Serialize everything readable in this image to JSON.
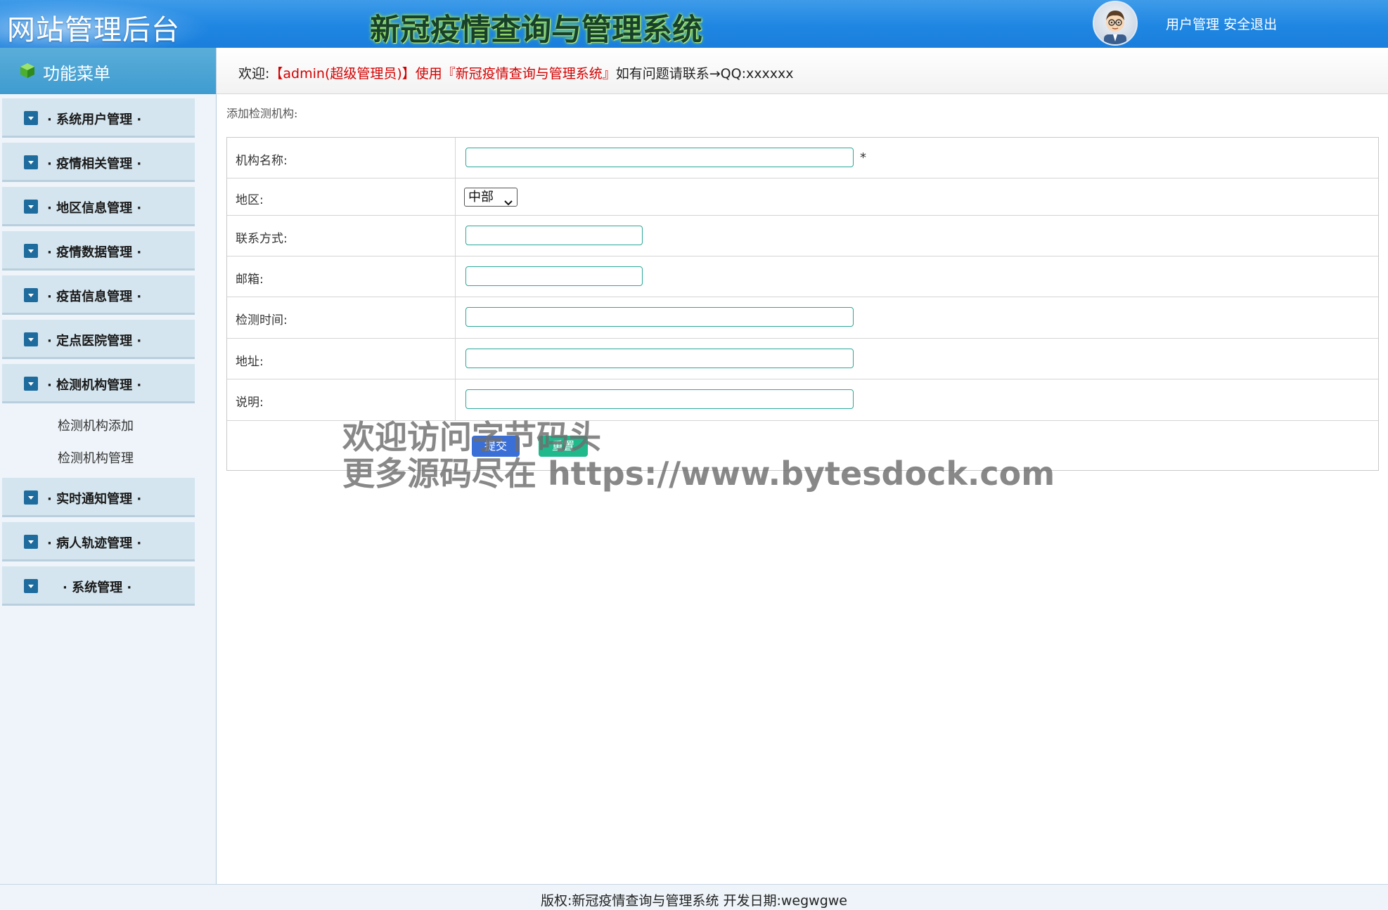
{
  "header": {
    "site_title": "网站管理后台",
    "system_title": "新冠疫情查询与管理系统",
    "user_manage_link": "用户管理",
    "logout_link": "安全退出"
  },
  "sidebar": {
    "menu_title": "功能菜单",
    "groups": [
      {
        "label": "· 系统用户管理 ·"
      },
      {
        "label": "· 疫情相关管理 ·"
      },
      {
        "label": "· 地区信息管理 ·"
      },
      {
        "label": "· 疫情数据管理 ·"
      },
      {
        "label": "· 疫苗信息管理 ·"
      },
      {
        "label": "· 定点医院管理 ·"
      },
      {
        "label": "· 检测机构管理 ·",
        "expanded": true,
        "items": [
          {
            "label": "检测机构添加"
          },
          {
            "label": "检测机构管理"
          }
        ]
      },
      {
        "label": "· 实时通知管理 ·"
      },
      {
        "label": "· 病人轨迹管理 ·"
      },
      {
        "label": "· 系统管理 ·"
      }
    ]
  },
  "welcome": {
    "prefix": "欢迎:",
    "highlight": "【admin(超级管理员)】使用『新冠疫情查询与管理系统』",
    "suffix": "如有问题请联系→QQ:xxxxxx"
  },
  "form": {
    "caption": "添加检测机构:",
    "fields": {
      "name": {
        "label": "机构名称:",
        "value": "",
        "required_mark": "*"
      },
      "region": {
        "label": "地区:",
        "selected": "中部"
      },
      "contact": {
        "label": "联系方式:",
        "value": ""
      },
      "email": {
        "label": "邮箱:",
        "value": ""
      },
      "test_time": {
        "label": "检测时间:",
        "value": ""
      },
      "address": {
        "label": "地址:",
        "value": ""
      },
      "description": {
        "label": "说明:",
        "value": ""
      }
    },
    "submit_label": "提交",
    "reset_label": "重置"
  },
  "watermark": {
    "line1": "欢迎访问字节码头",
    "line2": "更多源码尽在  https://www.bytesdock.com"
  },
  "footer": {
    "text": "版权:新冠疫情查询与管理系统 开发日期:wegwgwe"
  },
  "colors": {
    "header_blue": "#1f86e2",
    "menu_head_blue": "#3f9bd0",
    "input_border_teal": "#2aa89a",
    "submit_blue": "#3a6fd8",
    "reset_green": "#20b98c",
    "welcome_red": "#d40000"
  },
  "icons": [
    "avatar-icon",
    "cube-icon",
    "chevron-down-icon",
    "select-arrow-icon"
  ]
}
